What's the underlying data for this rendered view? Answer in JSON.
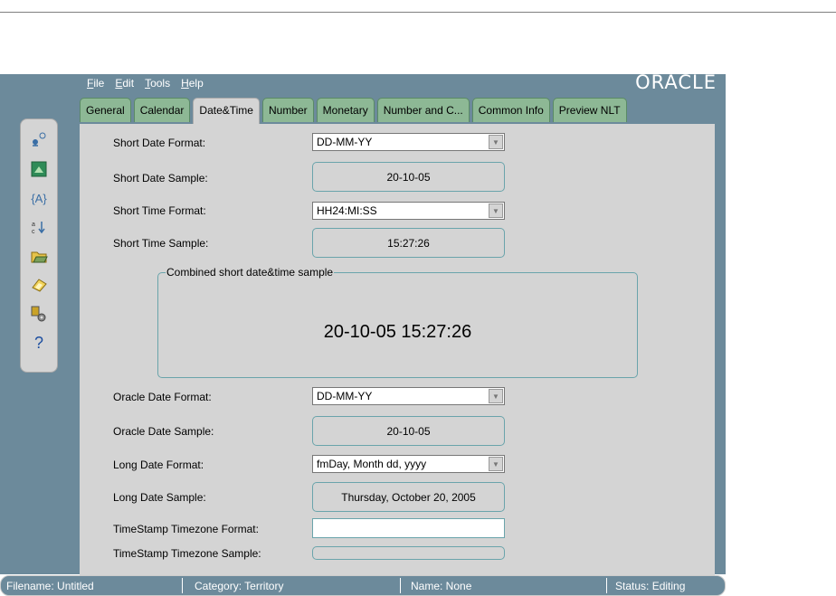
{
  "menu": [
    "File",
    "Edit",
    "Tools",
    "Help"
  ],
  "menu_mnemonics": [
    "F",
    "E",
    "T",
    "H"
  ],
  "brand": "ORACLE",
  "tabs": [
    "General",
    "Calendar",
    "Date&Time",
    "Number",
    "Monetary",
    "Number and C...",
    "Common Info",
    "Preview NLT"
  ],
  "active_tab": "Date&Time",
  "toolbar_icons": [
    "connect-icon",
    "image-icon",
    "variable-icon",
    "sort-icon",
    "open-folder-icon",
    "save-disk-icon",
    "settings-icon",
    "help-icon"
  ],
  "fields": {
    "short_date_format": {
      "label": "Short Date Format:",
      "value": "DD-MM-YY"
    },
    "short_date_sample": {
      "label": "Short Date Sample:",
      "value": "20-10-05"
    },
    "short_time_format": {
      "label": "Short Time Format:",
      "value": "HH24:MI:SS"
    },
    "short_time_sample": {
      "label": "Short Time Sample:",
      "value": "15:27:26"
    },
    "combined": {
      "title": "Combined short date&time sample",
      "value": "20-10-05 15:27:26"
    },
    "oracle_date_format": {
      "label": "Oracle Date Format:",
      "value": "DD-MM-YY"
    },
    "oracle_date_sample": {
      "label": "Oracle Date Sample:",
      "value": "20-10-05"
    },
    "long_date_format": {
      "label": "Long Date Format:",
      "value": "fmDay, Month dd, yyyy"
    },
    "long_date_sample": {
      "label": "Long Date Sample:",
      "value": "Thursday, October 20, 2005"
    },
    "timestamp_tz_format": {
      "label": "TimeStamp Timezone Format:",
      "value": ""
    },
    "timestamp_tz_sample": {
      "label": "TimeStamp Timezone Sample:",
      "value": ""
    }
  },
  "status": {
    "filename": "Filename: Untitled",
    "category": "Category: Territory",
    "name": "Name: None",
    "status": "Status: Editing"
  },
  "colors": {
    "chrome": "#6c8a9b",
    "tab": "#8db895",
    "panel": "#d4d4d4",
    "field_border": "#6aa4ab"
  }
}
